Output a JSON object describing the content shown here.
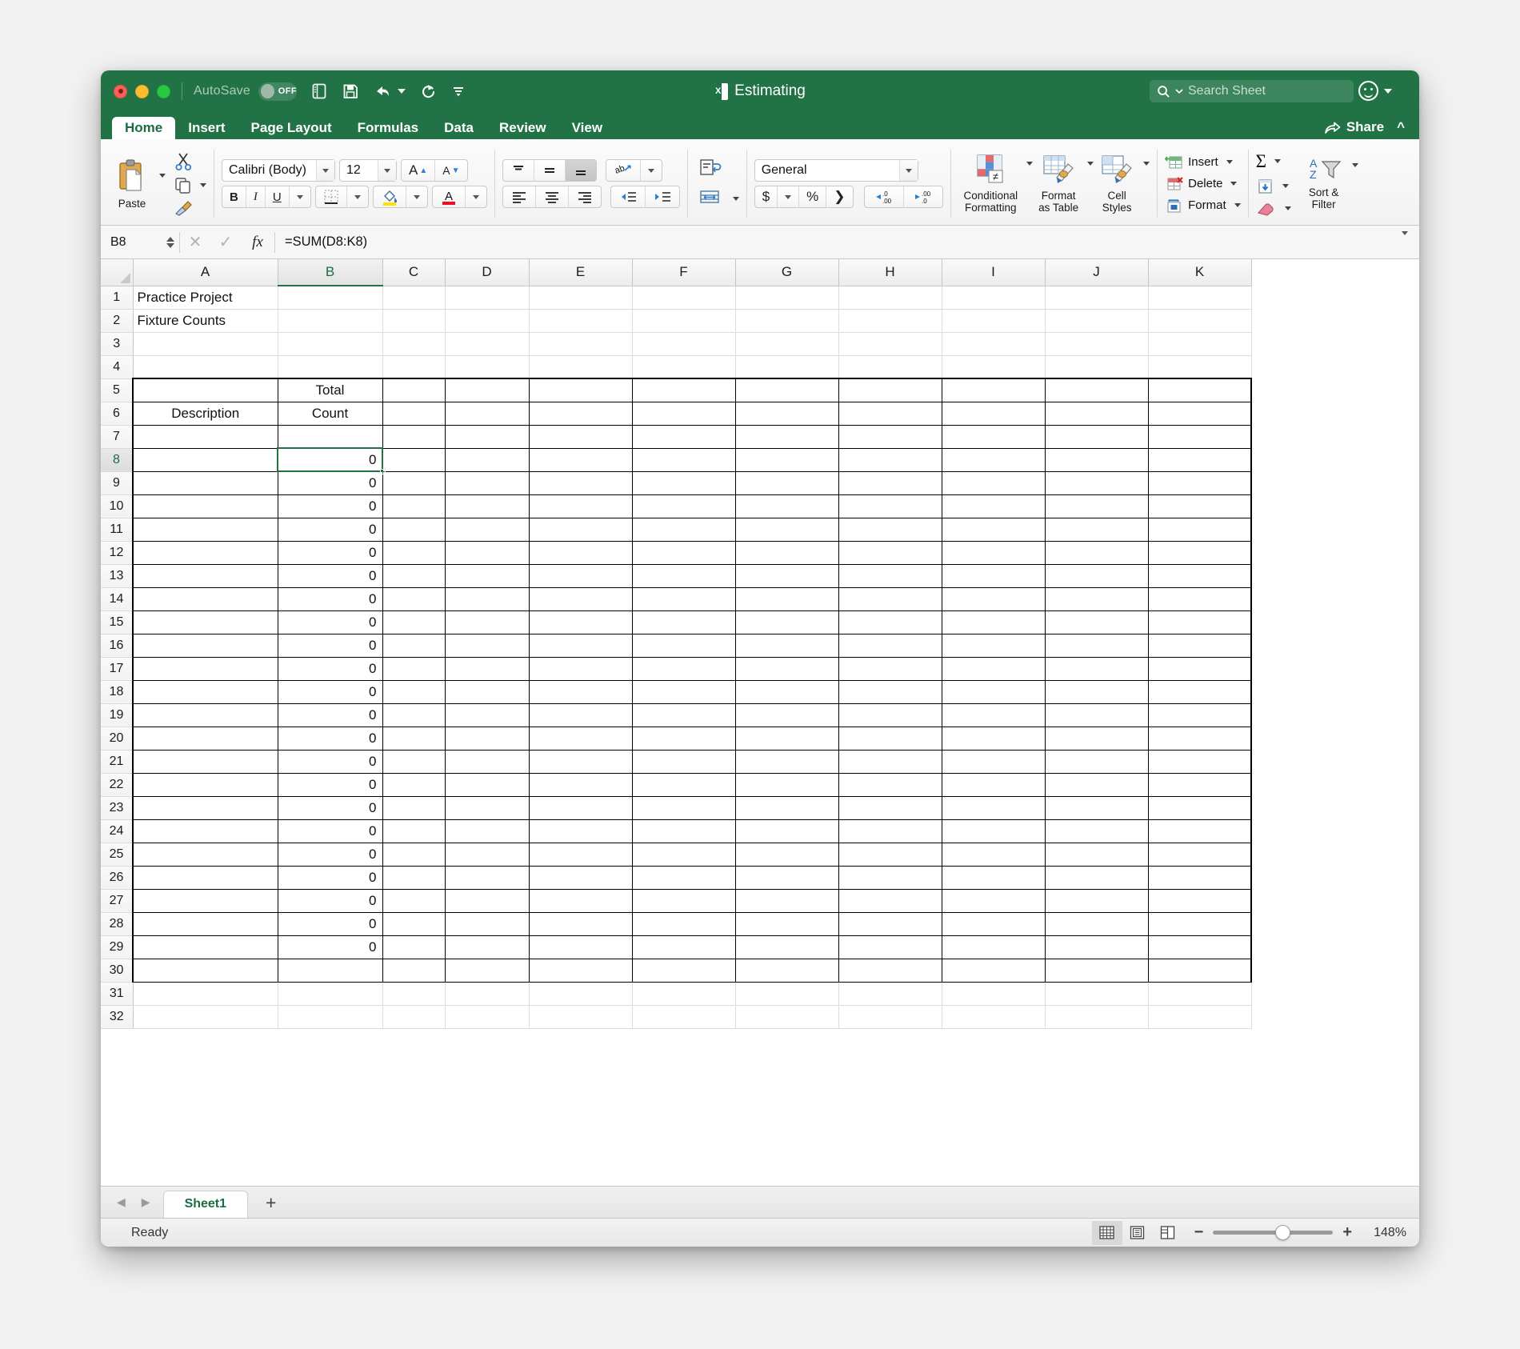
{
  "titlebar": {
    "autosave_label": "AutoSave",
    "autosave_state": "OFF",
    "document_title": "Estimating",
    "quick_access": [
      "new-sheet-icon",
      "save-icon",
      "undo-icon",
      "redo-icon",
      "customize-icon"
    ],
    "search_placeholder": "Search Sheet",
    "search_value": ""
  },
  "tabs": [
    {
      "label": "Home",
      "active": true
    },
    {
      "label": "Insert",
      "active": false
    },
    {
      "label": "Page Layout",
      "active": false
    },
    {
      "label": "Formulas",
      "active": false
    },
    {
      "label": "Data",
      "active": false
    },
    {
      "label": "Review",
      "active": false
    },
    {
      "label": "View",
      "active": false
    }
  ],
  "share": {
    "label": "Share"
  },
  "ribbon": {
    "clipboard": {
      "paste_label": "Paste",
      "cut": "cut-icon",
      "copy": "copy-icon",
      "format_painter": "format-painter-icon"
    },
    "font": {
      "family": "Calibri (Body)",
      "size": "12",
      "grow": "A▴",
      "shrink": "A▾",
      "bold": "B",
      "italic": "I",
      "underline": "U"
    },
    "alignment": {
      "vtop": "align-top-icon",
      "vmiddle": "align-middle-icon",
      "vbottom": "align-bottom-icon",
      "orientation": "text-orientation-icon",
      "left": "align-left-icon",
      "center": "align-center-icon",
      "right": "align-right-icon",
      "decrease_indent": "decrease-indent-icon",
      "increase_indent": "increase-indent-icon",
      "wrap_text": "wrap-text-icon",
      "merge": "merge-cells-icon"
    },
    "number": {
      "format": "General",
      "currency": "$",
      "percent": "%",
      "comma": "❯",
      "increase_decimal": ".00",
      "decrease_decimal": ".0"
    },
    "styles": [
      {
        "label_line1": "Conditional",
        "label_line2": "Formatting"
      },
      {
        "label_line1": "Format",
        "label_line2": "as Table"
      },
      {
        "label_line1": "Cell",
        "label_line2": "Styles"
      }
    ],
    "cells": [
      {
        "label": "Insert"
      },
      {
        "label": "Delete"
      },
      {
        "label": "Format"
      }
    ],
    "editing": {
      "autosum": "Σ",
      "fill": "fill-icon",
      "clear": "clear-eraser-icon",
      "sort_filter_line1": "Sort &",
      "sort_filter_line2": "Filter"
    }
  },
  "formula_bar": {
    "name_box": "B8",
    "cancel": "✕",
    "confirm": "✓",
    "fx": "fx",
    "formula": "=SUM(D8:K8)"
  },
  "grid": {
    "columns": [
      "A",
      "B",
      "C",
      "D",
      "E",
      "F",
      "G",
      "H",
      "I",
      "J",
      "K"
    ],
    "selected_column": "B",
    "selected_row": 8,
    "selected_cell": "B8",
    "rows": [
      {
        "n": 1,
        "a": "Practice Project",
        "b": ""
      },
      {
        "n": 2,
        "a": "Fixture Counts",
        "b": ""
      },
      {
        "n": 3,
        "a": "",
        "b": ""
      },
      {
        "n": 4,
        "a": "",
        "b": ""
      },
      {
        "n": 5,
        "a": "",
        "b": "Total"
      },
      {
        "n": 6,
        "a": "Description",
        "b": "Count"
      },
      {
        "n": 7,
        "a": "",
        "b": ""
      },
      {
        "n": 8,
        "a": "",
        "b": "0"
      },
      {
        "n": 9,
        "a": "",
        "b": "0"
      },
      {
        "n": 10,
        "a": "",
        "b": "0"
      },
      {
        "n": 11,
        "a": "",
        "b": "0"
      },
      {
        "n": 12,
        "a": "",
        "b": "0"
      },
      {
        "n": 13,
        "a": "",
        "b": "0"
      },
      {
        "n": 14,
        "a": "",
        "b": "0"
      },
      {
        "n": 15,
        "a": "",
        "b": "0"
      },
      {
        "n": 16,
        "a": "",
        "b": "0"
      },
      {
        "n": 17,
        "a": "",
        "b": "0"
      },
      {
        "n": 18,
        "a": "",
        "b": "0"
      },
      {
        "n": 19,
        "a": "",
        "b": "0"
      },
      {
        "n": 20,
        "a": "",
        "b": "0"
      },
      {
        "n": 21,
        "a": "",
        "b": "0"
      },
      {
        "n": 22,
        "a": "",
        "b": "0"
      },
      {
        "n": 23,
        "a": "",
        "b": "0"
      },
      {
        "n": 24,
        "a": "",
        "b": "0"
      },
      {
        "n": 25,
        "a": "",
        "b": "0"
      },
      {
        "n": 26,
        "a": "",
        "b": "0"
      },
      {
        "n": 27,
        "a": "",
        "b": "0"
      },
      {
        "n": 28,
        "a": "",
        "b": "0"
      },
      {
        "n": 29,
        "a": "",
        "b": "0"
      },
      {
        "n": 30,
        "a": "",
        "b": ""
      },
      {
        "n": 31,
        "a": "",
        "b": ""
      },
      {
        "n": 32,
        "a": "",
        "b": ""
      }
    ]
  },
  "sheet_tabs": {
    "prev": "◀",
    "next": "▶",
    "tabs": [
      {
        "label": "Sheet1",
        "active": true
      }
    ],
    "add": "+"
  },
  "statusbar": {
    "status": "Ready",
    "views": [
      "normal-view-icon",
      "page-layout-view-icon",
      "page-break-view-icon"
    ],
    "zoom_out": "−",
    "zoom_in": "+",
    "zoom_level": "148%"
  },
  "colors": {
    "excel_green": "#217346",
    "selection_green": "#1d6b42",
    "traffic_red": "#ff5f57",
    "traffic_yellow": "#febc2e",
    "traffic_green": "#28c840"
  }
}
